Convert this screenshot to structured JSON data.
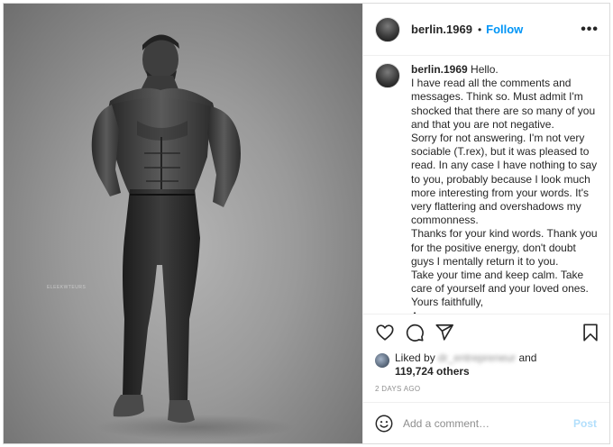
{
  "header": {
    "username": "berlin.1969",
    "separator": "•",
    "follow_label": "Follow",
    "more_label": "•••"
  },
  "photo": {
    "watermark": "ELEEKWTEURS"
  },
  "caption": {
    "username": "berlin.1969",
    "text": " Hello.\nI have read all the comments and messages. Think so. Must admit I'm shocked that there are so many of you and that you are not negative.\nSorry for not answering. I'm not very sociable (T.rex), but it was pleased to read. In any case I have nothing to say to you, probably because I look much more interesting from your words. It's very flattering and overshadows my commonness.\nThanks for your kind words. Thank you for the positive energy, don't doubt guys I mentally return it to you.\nTake your time and keep calm. Take care of yourself and your loved ones.\nYours faithfully,\nAverage person."
  },
  "actions": {
    "like_icon": "heart-icon",
    "comment_icon": "speech-bubble-icon",
    "share_icon": "paper-plane-icon",
    "save_icon": "bookmark-icon"
  },
  "likes": {
    "prefix": "Liked by",
    "blurred_user": "dr_entrepreneur",
    "and": "and",
    "count_text": "119,724 others"
  },
  "timestamp": "2 DAYS AGO",
  "comment_box": {
    "emoji_icon": "smiley-icon",
    "placeholder": "Add a comment…",
    "post_label": "Post"
  },
  "colors": {
    "accent": "#0095f6",
    "post_disabled": "#b2dffc",
    "text": "#262626",
    "muted": "#8e8e8e",
    "border": "#dbdbdb"
  }
}
